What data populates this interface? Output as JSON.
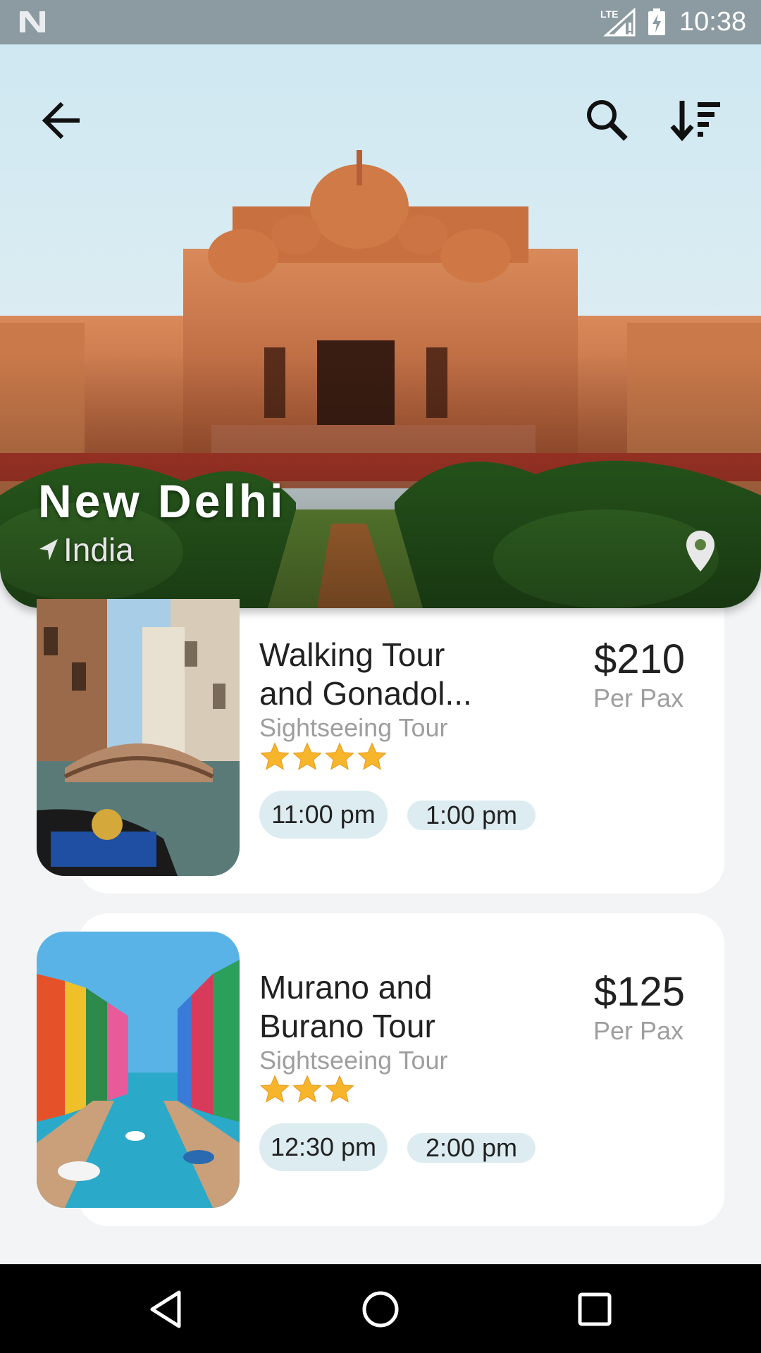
{
  "status_bar": {
    "network": "LTE",
    "time": "10:38"
  },
  "hero": {
    "city": "New Delhi",
    "country": "India",
    "icons": {
      "back": "arrow-back-icon",
      "search": "search-icon",
      "sort": "sort-icon",
      "pin": "map-pin-icon"
    }
  },
  "tours": [
    {
      "title": "Walking Tour and Gonadol...",
      "category": "Sightseeing Tour",
      "rating": 4,
      "price": "$210",
      "price_unit": "Per Pax",
      "times": [
        "11:00 pm",
        "1:00 pm"
      ]
    },
    {
      "title": "Murano and Burano Tour",
      "category": "Sightseeing Tour",
      "rating": 3,
      "price": "$125",
      "price_unit": "Per Pax",
      "times": [
        "12:30 pm",
        "2:00 pm"
      ]
    }
  ],
  "colors": {
    "star": "#f7b52c",
    "chip_bg": "#dcecf1",
    "status_bar": "#8c9aa1"
  },
  "nav_bar": {
    "icons": [
      "nav-back-icon",
      "nav-home-icon",
      "nav-recents-icon"
    ]
  }
}
